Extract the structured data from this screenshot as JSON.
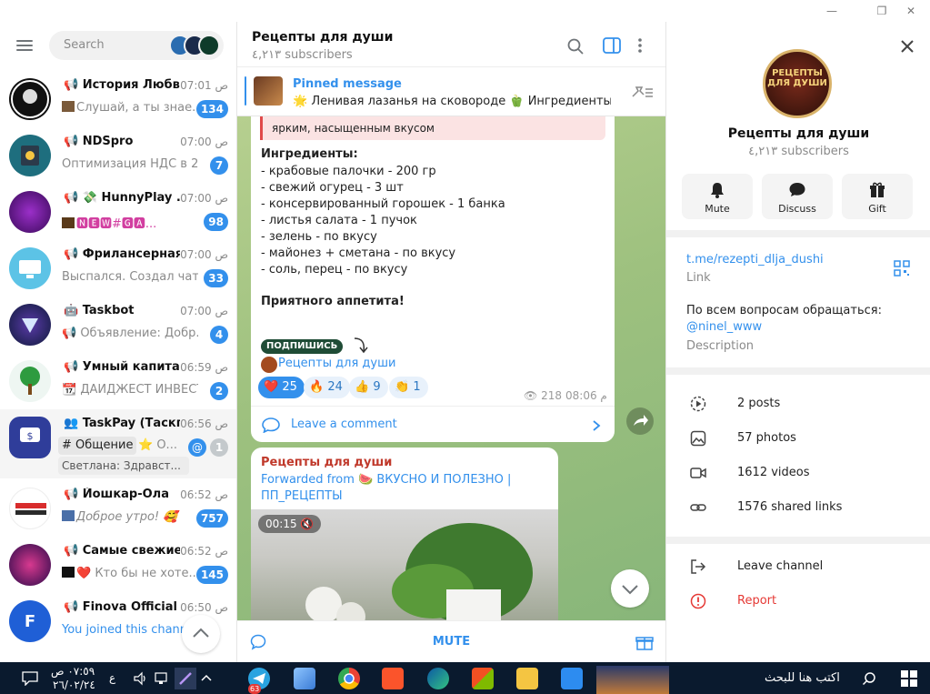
{
  "sidebar": {
    "search_placeholder": "Search",
    "chats": [
      {
        "title": "История Любви",
        "time": "07:01 ص",
        "preview": "Слушай, а ты знае...",
        "badge": "134"
      },
      {
        "title": "NDSpro",
        "time": "07:00 ص",
        "preview": "Оптимизация НДС в 20...",
        "badge": "7"
      },
      {
        "title": "HunnyPlay ...",
        "time": "07:00 ص",
        "preview": "🅽🅴🆆#🅶🅰...",
        "badge": "98"
      },
      {
        "title": "Фрилансерная",
        "time": "07:00 ص",
        "preview": "Выспался. Создал чат-б...",
        "badge": "33"
      },
      {
        "title": "Taskbot",
        "time": "07:00 ص",
        "preview": "Объявление: Добр...",
        "badge": "4"
      },
      {
        "title": "Умный капитал",
        "time": "06:59 ص",
        "preview": "ДАЙДЖЕСТ ИНВЕСТ...",
        "badge": "2"
      },
      {
        "title": "TaskPay (Таскп...",
        "time": "06:56 ص",
        "preview": "# Общение",
        "preview2": "Светлана: Здравст...",
        "badge": "1",
        "topic_extra": "О..."
      },
      {
        "title": "Йошкар-Ола",
        "time": "06:52 ص",
        "preview": "Доброе утро!",
        "badge": "757"
      },
      {
        "title": "Самые свежие ...",
        "time": "06:52 ص",
        "preview": "Кто бы не хоте...",
        "badge": "145"
      },
      {
        "title": "Finova Official",
        "time": "06:50 ص",
        "preview": "You joined this channel"
      }
    ]
  },
  "channel": {
    "title": "Рецепты для души",
    "subscribers": "٤,٢١٣ subscribers",
    "pinned_label": "Pinned message",
    "pinned_text": "🌟 Ленивая лазанья на сковороде 🫑 Ингредиенты: ...",
    "quote_text": "ярким, насыщенным вкусом",
    "ingredients_head": "Ингредиенты:",
    "ingredients": [
      "- крабовые палочки - 200 гр",
      "- свежий огурец - 3 шт",
      "- консервированный горошек - 1 банка",
      "- листья салата - 1 пучок",
      "- зелень - по вкусу",
      "- майонез + сметана - по вкусу",
      "- соль, перец - по вкусу"
    ],
    "bon_appetit": "Приятного аппетита!",
    "subscribe_tag": "ПОДПИШИСЬ",
    "channel_link": "Рецепты для души",
    "reactions": [
      {
        "emoji": "❤️",
        "count": "25"
      },
      {
        "emoji": "🔥",
        "count": "24"
      },
      {
        "emoji": "👍",
        "count": "9"
      },
      {
        "emoji": "👏",
        "count": "1"
      }
    ],
    "views": "218",
    "time": "08:06 م",
    "comment": "Leave a comment",
    "msg2_author": "Рецепты для души",
    "msg2_forwarded": "Forwarded from",
    "msg2_source": "ВКУСНО И ПОЛЕЗНО | ПП_РЕЦЕПТЫ",
    "video_time": "00:15",
    "mute": "MUTE"
  },
  "info": {
    "title": "Рецепты для души",
    "subscribers": "٤,٢١٣ subscribers",
    "avatar_text": "РЕЦЕПТЫ ДЛЯ ДУШИ",
    "actions": [
      "Mute",
      "Discuss",
      "Gift"
    ],
    "link": "t.me/rezepti_dlja_dushi",
    "link_label": "Link",
    "description": "По всем вопросам обращаться:",
    "handle": "@ninel_www",
    "description_label": "Description",
    "media": [
      {
        "label": "2 posts",
        "icon": "posts-icon"
      },
      {
        "label": "57 photos",
        "icon": "photo-icon"
      },
      {
        "label": "1612 videos",
        "icon": "video-icon"
      },
      {
        "label": "1576 shared links",
        "icon": "link-icon"
      }
    ],
    "leave": "Leave channel",
    "report": "Report"
  },
  "taskbar": {
    "search": "اكتب هنا للبحث",
    "time": "٠٧:٥٩ ص",
    "date": "٢٦/٠٢/٢٤",
    "lang": "ع",
    "telegram_badge": "63"
  },
  "colors": {
    "accent": "#3390ec",
    "report": "#e53935",
    "taskbar": "#0a1a2e"
  }
}
